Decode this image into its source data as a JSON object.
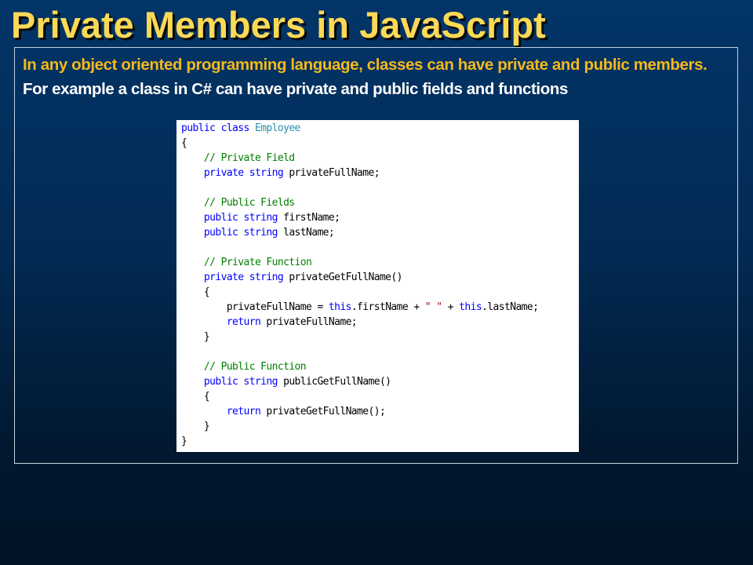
{
  "slide": {
    "title": "Private Members in JavaScript",
    "intro_highlight": "In any object oriented programming language, classes can have private and public members.",
    "intro_rest": " For example a class in C# can have private and public fields and functions"
  },
  "code_colors": {
    "keyword": "#0000ff",
    "type": "#2b91af",
    "comment": "#008000",
    "string": "#a31515",
    "plain": "#000000"
  },
  "code": {
    "language": "C#",
    "lines": [
      [
        {
          "t": "public class ",
          "c": "keyword"
        },
        {
          "t": "Employee",
          "c": "type"
        }
      ],
      [
        {
          "t": "{",
          "c": "plain"
        }
      ],
      [
        {
          "t": "    // Private Field",
          "c": "comment"
        }
      ],
      [
        {
          "t": "    private string ",
          "c": "keyword"
        },
        {
          "t": "privateFullName;",
          "c": "plain"
        }
      ],
      [],
      [
        {
          "t": "    // Public Fields",
          "c": "comment"
        }
      ],
      [
        {
          "t": "    public string ",
          "c": "keyword"
        },
        {
          "t": "firstName;",
          "c": "plain"
        }
      ],
      [
        {
          "t": "    public string ",
          "c": "keyword"
        },
        {
          "t": "lastName;",
          "c": "plain"
        }
      ],
      [],
      [
        {
          "t": "    // Private Function",
          "c": "comment"
        }
      ],
      [
        {
          "t": "    private string ",
          "c": "keyword"
        },
        {
          "t": "privateGetFullName()",
          "c": "plain"
        }
      ],
      [
        {
          "t": "    {",
          "c": "plain"
        }
      ],
      [
        {
          "t": "        privateFullName = ",
          "c": "plain"
        },
        {
          "t": "this",
          "c": "keyword"
        },
        {
          "t": ".firstName + ",
          "c": "plain"
        },
        {
          "t": "\" \"",
          "c": "string"
        },
        {
          "t": " + ",
          "c": "plain"
        },
        {
          "t": "this",
          "c": "keyword"
        },
        {
          "t": ".lastName;",
          "c": "plain"
        }
      ],
      [
        {
          "t": "        return ",
          "c": "keyword"
        },
        {
          "t": "privateFullName;",
          "c": "plain"
        }
      ],
      [
        {
          "t": "    }",
          "c": "plain"
        }
      ],
      [],
      [
        {
          "t": "    // Public Function",
          "c": "comment"
        }
      ],
      [
        {
          "t": "    public string ",
          "c": "keyword"
        },
        {
          "t": "publicGetFullName()",
          "c": "plain"
        }
      ],
      [
        {
          "t": "    {",
          "c": "plain"
        }
      ],
      [
        {
          "t": "        return ",
          "c": "keyword"
        },
        {
          "t": "privateGetFullName();",
          "c": "plain"
        }
      ],
      [
        {
          "t": "    }",
          "c": "plain"
        }
      ],
      [
        {
          "t": "}",
          "c": "plain"
        }
      ]
    ]
  }
}
